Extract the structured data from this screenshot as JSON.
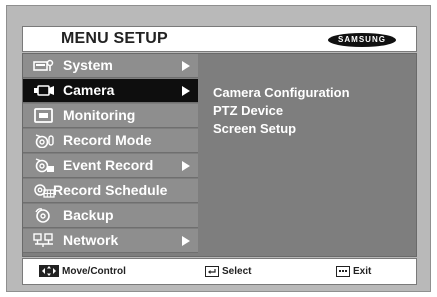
{
  "header": {
    "title": "MENU SETUP",
    "logo_text": "SAMSUNG"
  },
  "menu": {
    "items": [
      {
        "label": "System",
        "icon": "system-icon",
        "has_submenu": true,
        "selected": false
      },
      {
        "label": "Camera",
        "icon": "camera-icon",
        "has_submenu": true,
        "selected": true
      },
      {
        "label": "Monitoring",
        "icon": "monitor-icon",
        "has_submenu": false,
        "selected": false
      },
      {
        "label": "Record Mode",
        "icon": "record-mode-icon",
        "has_submenu": false,
        "selected": false
      },
      {
        "label": "Event Record",
        "icon": "event-record-icon",
        "has_submenu": true,
        "selected": false
      },
      {
        "label": "Record Schedule",
        "icon": "record-schedule-icon",
        "has_submenu": false,
        "selected": false
      },
      {
        "label": "Backup",
        "icon": "backup-icon",
        "has_submenu": false,
        "selected": false
      },
      {
        "label": "Network",
        "icon": "network-icon",
        "has_submenu": true,
        "selected": false
      }
    ]
  },
  "submenu": {
    "items": [
      "Camera Configuration",
      "PTZ Device",
      "Screen Setup"
    ]
  },
  "footer": {
    "move_label": "Move/Control",
    "select_label": "Select",
    "exit_label": "Exit"
  },
  "colors": {
    "bezel": "#b9b9b9",
    "panel": "#7e7e7e",
    "menu_item": "#8e8e8e",
    "menu_selected": "#0e0e0e",
    "text": "#ffffff"
  }
}
